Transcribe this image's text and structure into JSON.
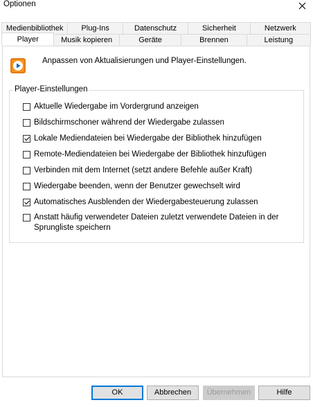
{
  "window": {
    "title": "Optionen"
  },
  "tabs": {
    "back_row": [
      "Medienbibliothek",
      "Plug-Ins",
      "Datenschutz",
      "Sicherheit",
      "Netzwerk"
    ],
    "front_row": [
      "Player",
      "Musik kopieren",
      "Geräte",
      "Brennen",
      "Leistung"
    ],
    "selected": "Player"
  },
  "player_tab": {
    "intro": "Anpassen von Aktualisierungen und Player-Einstellungen.",
    "group_label": "Player-Einstellungen",
    "options": [
      {
        "label": "Aktuelle Wiedergabe im Vordergrund anzeigen",
        "checked": false
      },
      {
        "label": "Bildschirmschoner während der Wiedergabe zulassen",
        "checked": false
      },
      {
        "label": "Lokale Mediendateien bei Wiedergabe der Bibliothek hinzufügen",
        "checked": true
      },
      {
        "label": "Remote-Mediendateien bei Wiedergabe der Bibliothek hinzufügen",
        "checked": false
      },
      {
        "label": "Verbinden mit dem Internet (setzt andere Befehle außer Kraft)",
        "checked": false
      },
      {
        "label": "Wiedergabe beenden, wenn der Benutzer gewechselt wird",
        "checked": false
      },
      {
        "label": "Automatisches Ausblenden der Wiedergabesteuerung zulassen",
        "checked": true
      },
      {
        "label": "Anstatt häufig verwendeter Dateien zuletzt verwendete Dateien in der Sprungliste speichern",
        "checked": false
      }
    ]
  },
  "buttons": {
    "ok": "OK",
    "cancel": "Abbrechen",
    "apply": "Übernehmen",
    "help": "Hilfe"
  },
  "colors": {
    "accent": "#0078d7",
    "icon_orange": "#f7941d"
  }
}
